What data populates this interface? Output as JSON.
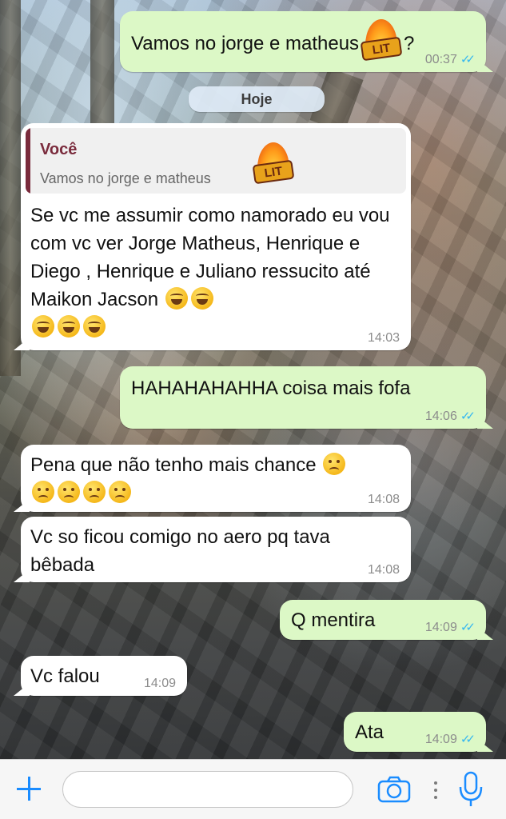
{
  "app": "WhatsApp",
  "date_separator": "Hoje",
  "colors": {
    "outgoing_bubble": "#dcf8c6",
    "incoming_bubble": "#ffffff",
    "read_ticks": "#34b7f1",
    "quote_accent": "#7a2b3c",
    "accent": "#1a8cff"
  },
  "messages": [
    {
      "id": "m1",
      "direction": "out",
      "text": "Vamos no jorge e matheus",
      "sticker": "LIT",
      "after_sticker": "?",
      "time": "00:37",
      "status": "read"
    },
    {
      "id": "m2",
      "direction": "in",
      "reply_to": {
        "author": "Você",
        "text": "Vamos no jorge e matheus",
        "sticker": "LIT"
      },
      "text": "Se vc me assumir como namorado eu vou com vc ver Jorge Matheus, Henrique e Diego , Henrique e Juliano ressucito até Maikon Jacson",
      "emoji_count": 5,
      "emoji": "rolling-on-floor-laughing-icon",
      "time": "14:03"
    },
    {
      "id": "m3",
      "direction": "out",
      "text": "HAHAHAHAHHA coisa mais fofa",
      "time": "14:06",
      "status": "read"
    },
    {
      "id": "m4",
      "direction": "in",
      "text": "Pena que não tenho mais chance",
      "emoji_count": 5,
      "emoji": "disappointed-face-icon",
      "time": "14:08"
    },
    {
      "id": "m5",
      "direction": "in",
      "text": "Vc so ficou comigo no aero pq tava bêbada",
      "time": "14:08"
    },
    {
      "id": "m6",
      "direction": "out",
      "text": "Q mentira",
      "time": "14:09",
      "status": "read"
    },
    {
      "id": "m7",
      "direction": "in",
      "text": "Vc falou",
      "time": "14:09"
    },
    {
      "id": "m8",
      "direction": "out",
      "text": "Ata",
      "time": "14:09",
      "status": "read"
    }
  ],
  "input_bar": {
    "placeholder": "",
    "icons": [
      "plus-icon",
      "camera-icon",
      "more-dots-icon",
      "microphone-icon"
    ]
  }
}
